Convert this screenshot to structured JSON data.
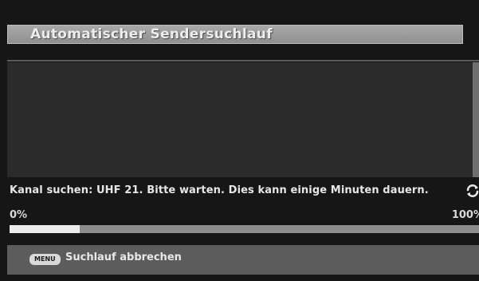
{
  "screen": {
    "title": "Automatischer Sendersuchlauf"
  },
  "scan": {
    "status_text": "Kanal suchen: UHF 21. Bitte warten. Dies kann einige Minuten dauern.",
    "progress_start_label": "0%",
    "progress_end_label": "100%",
    "progress_fraction": 0.15,
    "activity_icon": "refresh-icon"
  },
  "footer": {
    "menu_key_label": "MENU",
    "cancel_label": "Suchlauf abbrechen"
  },
  "colors": {
    "background": "#161616",
    "header": "#9a9a9a",
    "progress_fill": "#ececec",
    "progress_track": "#8c8c8c",
    "footer": "#5c5c5c"
  }
}
